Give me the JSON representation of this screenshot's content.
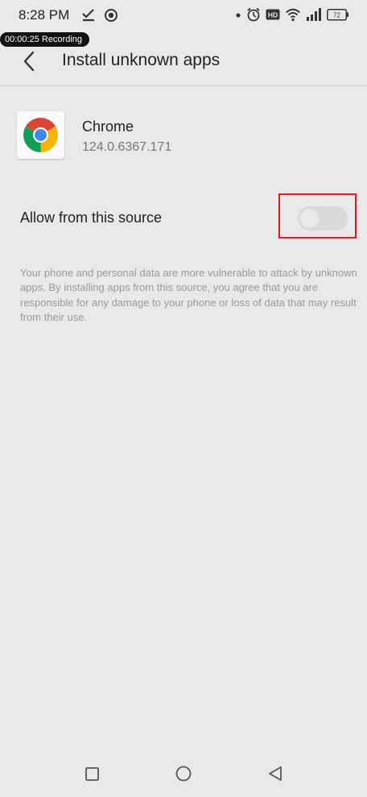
{
  "status_bar": {
    "time": "8:28 PM",
    "left_icons": [
      "download-check-icon",
      "screen-record-icon"
    ],
    "right_icons": [
      "dot-icon",
      "alarm-icon",
      "hd-icon",
      "wifi-icon",
      "signal-icon",
      "battery-icon"
    ],
    "hd_text": "HD",
    "battery_level": "72"
  },
  "recording": {
    "label": "00:00:25 Recording"
  },
  "app_bar": {
    "back_icon": "back-arrow-icon",
    "title": "Install unknown apps"
  },
  "app": {
    "icon": "chrome-logo-icon",
    "name": "Chrome",
    "version": "124.0.6367.171"
  },
  "setting": {
    "label": "Allow from this source",
    "enabled": false,
    "highlight_color": "#e01b1b"
  },
  "disclaimer": "Your phone and personal data are more vulnerable to attack by unknown apps. By installing apps from this source, you agree that you are responsible for any damage to your phone or loss of data that may result from their use.",
  "nav_bar": {
    "buttons": [
      "recents-square-icon",
      "home-circle-icon",
      "back-triangle-icon"
    ]
  }
}
